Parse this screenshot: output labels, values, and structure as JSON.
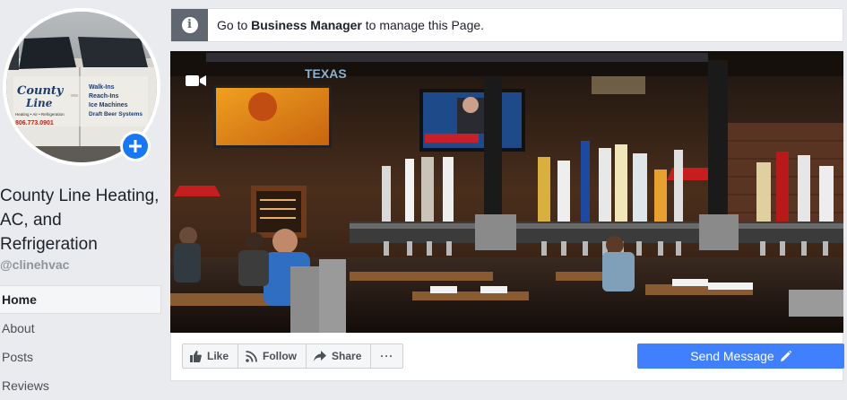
{
  "page": {
    "name": "County Line Heating, AC, and Refrigeration",
    "handle": "@clinehvac"
  },
  "profile_photo": {
    "truck_text": {
      "brand_line1": "County",
      "brand_line2": "Line",
      "tagline": "Heating • Air • Refrigeration",
      "phone": "806.773.0901",
      "services": [
        "Walk-Ins",
        "Reach-Ins",
        "Ice Machines",
        "Draft Beer Systems"
      ]
    }
  },
  "nav": {
    "items": [
      {
        "label": "Home"
      },
      {
        "label": "About"
      },
      {
        "label": "Posts"
      },
      {
        "label": "Reviews"
      }
    ]
  },
  "notice": {
    "prefix": "Go to ",
    "link": "Business Manager",
    "suffix": " to manage this Page."
  },
  "actions": {
    "like": "Like",
    "follow": "Follow",
    "share": "Share",
    "more": "···",
    "send_message": "Send Message"
  },
  "icons": {
    "info": "info-icon",
    "add_photo": "plus-icon",
    "cover_video": "video-camera-icon",
    "like": "thumbs-up-icon",
    "follow": "rss-icon",
    "share": "share-arrow-icon",
    "send": "pencil-icon"
  },
  "colors": {
    "accent": "#4080ff",
    "plus_button": "#1877f2",
    "page_bg": "#e9ebee"
  }
}
